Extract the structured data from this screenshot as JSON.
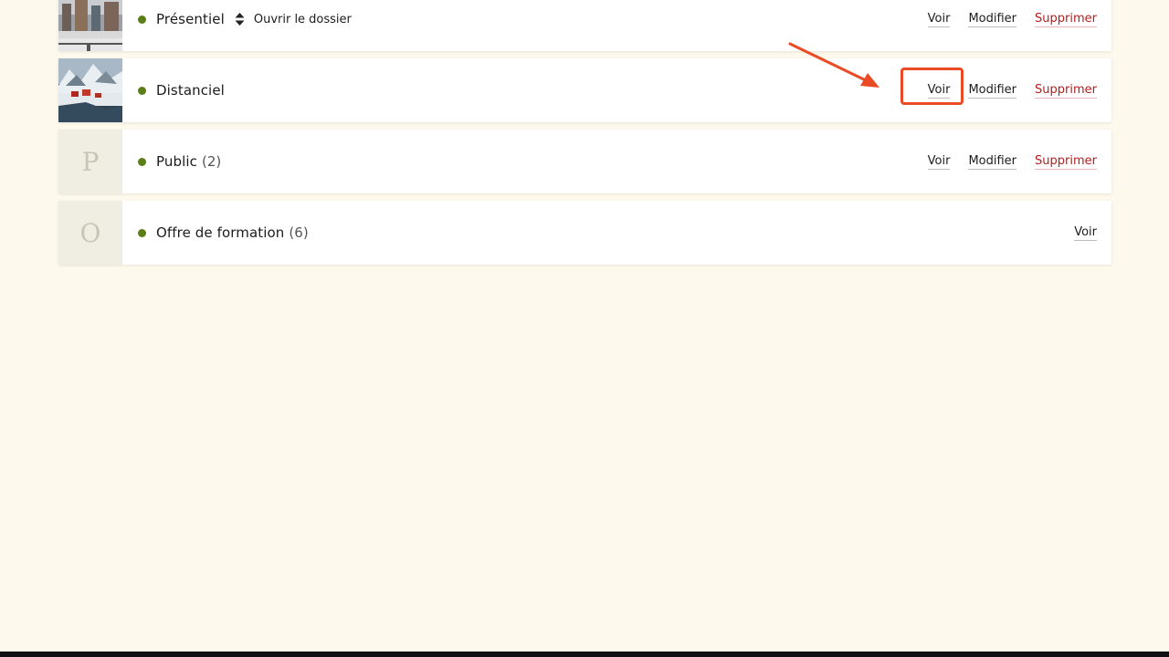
{
  "colors": {
    "page_background": "#fdfaed",
    "status_dot": "#5b7e17",
    "delete_link": "#b71c1c",
    "annotation": "#ea4b24"
  },
  "rows": [
    {
      "title": "Présentiel",
      "count": "",
      "thumb": "photo-street",
      "sort_icon": "sort-updown-icon",
      "open_folder": "Ouvrir le dossier",
      "actions": {
        "view": "Voir",
        "edit": "Modifier",
        "delete": "Supprimer"
      }
    },
    {
      "title": "Distanciel",
      "count": "",
      "thumb": "photo-snowy-village",
      "actions": {
        "view": "Voir",
        "edit": "Modifier",
        "delete": "Supprimer"
      }
    },
    {
      "title": "Public",
      "count": "(2)",
      "thumb_letter": "P",
      "actions": {
        "view": "Voir",
        "edit": "Modifier",
        "delete": "Supprimer"
      }
    },
    {
      "title": "Offre de formation",
      "count": "(6)",
      "thumb_letter": "O",
      "actions": {
        "view": "Voir"
      }
    }
  ],
  "annotation": {
    "type": "highlight-with-arrow",
    "target": "Voir (Distanciel)"
  }
}
